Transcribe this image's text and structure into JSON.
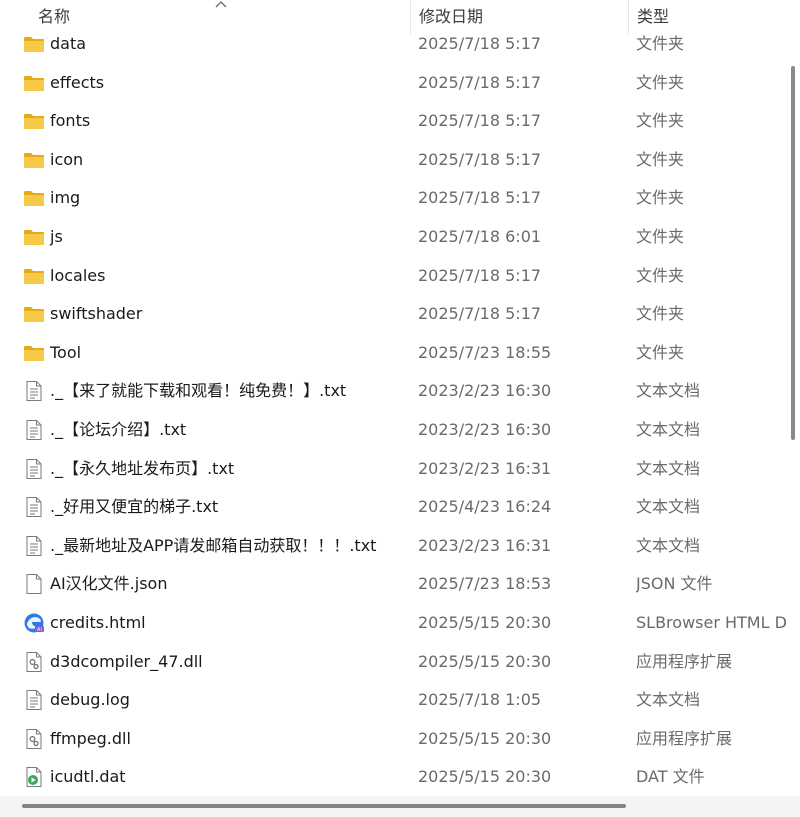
{
  "columns": {
    "name": "名称",
    "date": "修改日期",
    "type": "类型"
  },
  "files": [
    {
      "name": "data",
      "date": "2025/7/18 5:17",
      "type": "文件夹",
      "icon": "folder-icon"
    },
    {
      "name": "effects",
      "date": "2025/7/18 5:17",
      "type": "文件夹",
      "icon": "folder-icon"
    },
    {
      "name": "fonts",
      "date": "2025/7/18 5:17",
      "type": "文件夹",
      "icon": "folder-icon"
    },
    {
      "name": "icon",
      "date": "2025/7/18 5:17",
      "type": "文件夹",
      "icon": "folder-icon"
    },
    {
      "name": "img",
      "date": "2025/7/18 5:17",
      "type": "文件夹",
      "icon": "folder-icon"
    },
    {
      "name": "js",
      "date": "2025/7/18 6:01",
      "type": "文件夹",
      "icon": "folder-icon"
    },
    {
      "name": "locales",
      "date": "2025/7/18 5:17",
      "type": "文件夹",
      "icon": "folder-icon"
    },
    {
      "name": "swiftshader",
      "date": "2025/7/18 5:17",
      "type": "文件夹",
      "icon": "folder-icon"
    },
    {
      "name": "Tool",
      "date": "2025/7/23 18:55",
      "type": "文件夹",
      "icon": "folder-icon"
    },
    {
      "name": "._【来了就能下载和观看！纯免费！】.txt",
      "date": "2023/2/23 16:30",
      "type": "文本文档",
      "icon": "text-file-icon"
    },
    {
      "name": "._【论坛介绍】.txt",
      "date": "2023/2/23 16:30",
      "type": "文本文档",
      "icon": "text-file-icon"
    },
    {
      "name": "._【永久地址发布页】.txt",
      "date": "2023/2/23 16:31",
      "type": "文本文档",
      "icon": "text-file-icon"
    },
    {
      "name": "._好用又便宜的梯子.txt",
      "date": "2025/4/23 16:24",
      "type": "文本文档",
      "icon": "text-file-icon"
    },
    {
      "name": "._最新地址及APP请发邮箱自动获取！！！.txt",
      "date": "2023/2/23 16:31",
      "type": "文本文档",
      "icon": "text-file-icon"
    },
    {
      "name": "AI汉化文件.json",
      "date": "2025/7/23 18:53",
      "type": "JSON 文件",
      "icon": "blank-file-icon"
    },
    {
      "name": "credits.html",
      "date": "2025/5/15 20:30",
      "type": "SLBrowser HTML D",
      "icon": "browser-icon"
    },
    {
      "name": "d3dcompiler_47.dll",
      "date": "2025/5/15 20:30",
      "type": "应用程序扩展",
      "icon": "dll-file-icon"
    },
    {
      "name": "debug.log",
      "date": "2025/7/18 1:05",
      "type": "文本文档",
      "icon": "text-file-icon"
    },
    {
      "name": "ffmpeg.dll",
      "date": "2025/5/15 20:30",
      "type": "应用程序扩展",
      "icon": "dll-file-icon"
    },
    {
      "name": "icudtl.dat",
      "date": "2025/5/15 20:30",
      "type": "DAT 文件",
      "icon": "media-file-icon"
    }
  ],
  "colors": {
    "folder": "#f7c948",
    "folder_dark": "#e8a917",
    "browser_blue": "#2d7be5",
    "media_green": "#3aa757"
  }
}
